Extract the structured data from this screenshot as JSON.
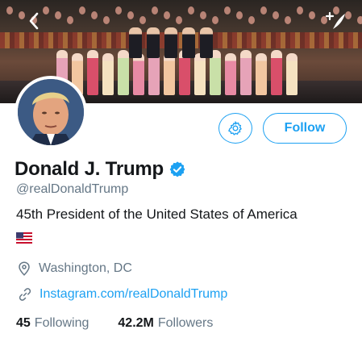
{
  "profile": {
    "display_name": "Donald J. Trump",
    "handle": "@realDonaldTrump",
    "bio": "45th President of the United States of America",
    "location": "Washington, DC",
    "website": "Instagram.com/realDonaldTrump",
    "verified": true
  },
  "actions": {
    "follow_label": "Follow"
  },
  "stats": {
    "following_count": "45",
    "following_label": "Following",
    "followers_count": "42.2M",
    "followers_label": "Followers"
  },
  "icons": {
    "back": "back-icon",
    "compose": "compose-icon",
    "settings": "gear-icon",
    "verified": "verified-badge-icon",
    "location": "location-pin-icon",
    "link": "link-icon",
    "flag": "us-flag-icon"
  },
  "colors": {
    "accent": "#1da1f2",
    "secondary_text": "#657786",
    "primary_text": "#14171a"
  }
}
